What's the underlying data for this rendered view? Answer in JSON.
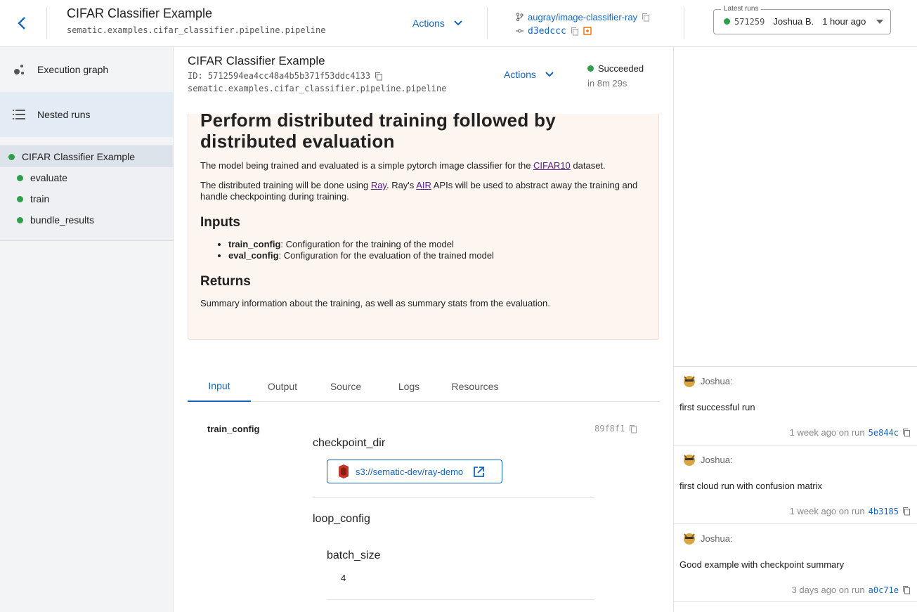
{
  "header": {
    "title": "CIFAR Classifier Example",
    "path": "sematic.examples.cifar_classifier.pipeline.pipeline",
    "actions_label": "Actions",
    "repo": "augray/image-classifier-ray",
    "commit": "d3edccc",
    "latest_runs_label": "Latest runs",
    "latest_run_id": "571259",
    "latest_run_user": "Joshua B.",
    "latest_run_time": "1 hour ago"
  },
  "sidebar": {
    "items": [
      {
        "label": "Execution graph"
      },
      {
        "label": "Nested runs"
      }
    ],
    "tree": [
      {
        "label": "CIFAR Classifier Example"
      },
      {
        "label": "evaluate"
      },
      {
        "label": "train"
      },
      {
        "label": "bundle_results"
      }
    ]
  },
  "run": {
    "title": "CIFAR Classifier Example",
    "id": "ID: 5712594ea4cc48a4b5b371f53ddc4133",
    "path": "sematic.examples.cifar_classifier.pipeline.pipeline",
    "actions_label": "Actions",
    "status": "Succeeded",
    "duration": "in 8m 29s"
  },
  "doc": {
    "heading": "Perform distributed training followed by distributed evaluation",
    "p1_pre": "The model being trained and evaluated is a simple pytorch image classifier for the ",
    "p1_link": "CIFAR10",
    "p1_post": " dataset.",
    "p2_a": "The distributed training will be done using ",
    "p2_link1": "Ray",
    "p2_b": ". Ray's ",
    "p2_link2": "AIR",
    "p2_c": " APIs will be used to abstract away the training and handle checkpointing during training.",
    "inputs_heading": "Inputs",
    "inputs": [
      {
        "name": "train_config",
        "desc": ": Configuration for the training of the model"
      },
      {
        "name": "eval_config",
        "desc": ": Configuration for the evaluation of the trained model"
      }
    ],
    "returns_heading": "Returns",
    "returns_text": "Summary information about the training, as well as summary stats from the evaluation."
  },
  "tabs": [
    {
      "label": "Input"
    },
    {
      "label": "Output"
    },
    {
      "label": "Source"
    },
    {
      "label": "Logs"
    },
    {
      "label": "Resources"
    }
  ],
  "input": {
    "param_name": "train_config",
    "hash": "89f8f1",
    "checkpoint_label": "checkpoint_dir",
    "s3_path": "s3://sematic-dev/ray-demo",
    "loop_label": "loop_config",
    "batch_label": "batch_size",
    "batch_value": "4"
  },
  "notes": [
    {
      "user": "Joshua:",
      "text": "first successful run",
      "time": "1 week ago on run",
      "run": "5e844c"
    },
    {
      "user": "Joshua:",
      "text": "first cloud run with confusion matrix",
      "time": "1 week ago on run",
      "run": "4b3185"
    },
    {
      "user": "Joshua:",
      "text": "Good example with checkpoint summary",
      "time": "3 days ago on run",
      "run": "a0c71e"
    }
  ]
}
